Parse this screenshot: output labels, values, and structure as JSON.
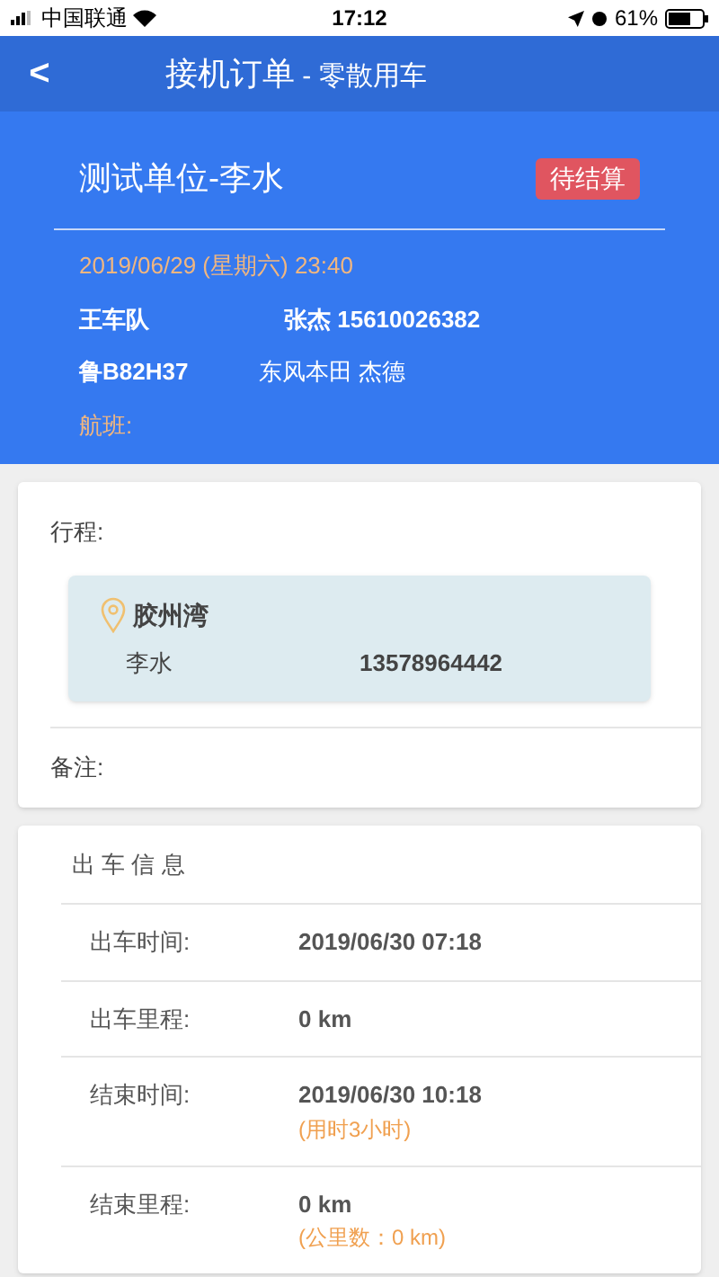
{
  "status_bar": {
    "carrier": "中国联通",
    "time": "17:12",
    "battery": "61%"
  },
  "nav": {
    "back": "<",
    "title": "接机订单",
    "subtitle": " - 零散用车"
  },
  "header": {
    "company": "测试单位-李水",
    "badge": "待结算",
    "datetime": "2019/06/29 (星期六) 23:40",
    "fleet": "王车队",
    "driver": "张杰 15610026382",
    "plate": "鲁B82H37",
    "car": "东风本田 杰德",
    "flight_label": "航班:"
  },
  "trip": {
    "label": "行程:",
    "place": "胶州湾",
    "contact": "李水",
    "phone": "13578964442",
    "remark_label": "备注:"
  },
  "info": {
    "title": "出 车 信 息",
    "rows": [
      {
        "label": "出车时间:",
        "value": "2019/06/30 07:18"
      },
      {
        "label": "出车里程:",
        "value": "0 km"
      },
      {
        "label": "结束时间:",
        "value": "2019/06/30 10:18",
        "note": "(用时3小时)"
      },
      {
        "label": "结束里程:",
        "value": "0 km",
        "note": "(公里数：0 km)"
      }
    ]
  }
}
